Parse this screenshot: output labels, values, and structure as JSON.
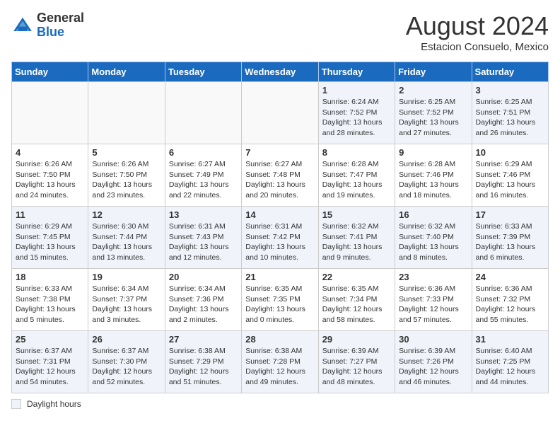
{
  "header": {
    "logo_general": "General",
    "logo_blue": "Blue",
    "month_title": "August 2024",
    "subtitle": "Estacion Consuelo, Mexico"
  },
  "days_of_week": [
    "Sunday",
    "Monday",
    "Tuesday",
    "Wednesday",
    "Thursday",
    "Friday",
    "Saturday"
  ],
  "legend_label": "Daylight hours",
  "weeks": [
    [
      {
        "day": "",
        "info": ""
      },
      {
        "day": "",
        "info": ""
      },
      {
        "day": "",
        "info": ""
      },
      {
        "day": "",
        "info": ""
      },
      {
        "day": "1",
        "info": "Sunrise: 6:24 AM\nSunset: 7:52 PM\nDaylight: 13 hours and 28 minutes."
      },
      {
        "day": "2",
        "info": "Sunrise: 6:25 AM\nSunset: 7:52 PM\nDaylight: 13 hours and 27 minutes."
      },
      {
        "day": "3",
        "info": "Sunrise: 6:25 AM\nSunset: 7:51 PM\nDaylight: 13 hours and 26 minutes."
      }
    ],
    [
      {
        "day": "4",
        "info": "Sunrise: 6:26 AM\nSunset: 7:50 PM\nDaylight: 13 hours and 24 minutes."
      },
      {
        "day": "5",
        "info": "Sunrise: 6:26 AM\nSunset: 7:50 PM\nDaylight: 13 hours and 23 minutes."
      },
      {
        "day": "6",
        "info": "Sunrise: 6:27 AM\nSunset: 7:49 PM\nDaylight: 13 hours and 22 minutes."
      },
      {
        "day": "7",
        "info": "Sunrise: 6:27 AM\nSunset: 7:48 PM\nDaylight: 13 hours and 20 minutes."
      },
      {
        "day": "8",
        "info": "Sunrise: 6:28 AM\nSunset: 7:47 PM\nDaylight: 13 hours and 19 minutes."
      },
      {
        "day": "9",
        "info": "Sunrise: 6:28 AM\nSunset: 7:46 PM\nDaylight: 13 hours and 18 minutes."
      },
      {
        "day": "10",
        "info": "Sunrise: 6:29 AM\nSunset: 7:46 PM\nDaylight: 13 hours and 16 minutes."
      }
    ],
    [
      {
        "day": "11",
        "info": "Sunrise: 6:29 AM\nSunset: 7:45 PM\nDaylight: 13 hours and 15 minutes."
      },
      {
        "day": "12",
        "info": "Sunrise: 6:30 AM\nSunset: 7:44 PM\nDaylight: 13 hours and 13 minutes."
      },
      {
        "day": "13",
        "info": "Sunrise: 6:31 AM\nSunset: 7:43 PM\nDaylight: 13 hours and 12 minutes."
      },
      {
        "day": "14",
        "info": "Sunrise: 6:31 AM\nSunset: 7:42 PM\nDaylight: 13 hours and 10 minutes."
      },
      {
        "day": "15",
        "info": "Sunrise: 6:32 AM\nSunset: 7:41 PM\nDaylight: 13 hours and 9 minutes."
      },
      {
        "day": "16",
        "info": "Sunrise: 6:32 AM\nSunset: 7:40 PM\nDaylight: 13 hours and 8 minutes."
      },
      {
        "day": "17",
        "info": "Sunrise: 6:33 AM\nSunset: 7:39 PM\nDaylight: 13 hours and 6 minutes."
      }
    ],
    [
      {
        "day": "18",
        "info": "Sunrise: 6:33 AM\nSunset: 7:38 PM\nDaylight: 13 hours and 5 minutes."
      },
      {
        "day": "19",
        "info": "Sunrise: 6:34 AM\nSunset: 7:37 PM\nDaylight: 13 hours and 3 minutes."
      },
      {
        "day": "20",
        "info": "Sunrise: 6:34 AM\nSunset: 7:36 PM\nDaylight: 13 hours and 2 minutes."
      },
      {
        "day": "21",
        "info": "Sunrise: 6:35 AM\nSunset: 7:35 PM\nDaylight: 13 hours and 0 minutes."
      },
      {
        "day": "22",
        "info": "Sunrise: 6:35 AM\nSunset: 7:34 PM\nDaylight: 12 hours and 58 minutes."
      },
      {
        "day": "23",
        "info": "Sunrise: 6:36 AM\nSunset: 7:33 PM\nDaylight: 12 hours and 57 minutes."
      },
      {
        "day": "24",
        "info": "Sunrise: 6:36 AM\nSunset: 7:32 PM\nDaylight: 12 hours and 55 minutes."
      }
    ],
    [
      {
        "day": "25",
        "info": "Sunrise: 6:37 AM\nSunset: 7:31 PM\nDaylight: 12 hours and 54 minutes."
      },
      {
        "day": "26",
        "info": "Sunrise: 6:37 AM\nSunset: 7:30 PM\nDaylight: 12 hours and 52 minutes."
      },
      {
        "day": "27",
        "info": "Sunrise: 6:38 AM\nSunset: 7:29 PM\nDaylight: 12 hours and 51 minutes."
      },
      {
        "day": "28",
        "info": "Sunrise: 6:38 AM\nSunset: 7:28 PM\nDaylight: 12 hours and 49 minutes."
      },
      {
        "day": "29",
        "info": "Sunrise: 6:39 AM\nSunset: 7:27 PM\nDaylight: 12 hours and 48 minutes."
      },
      {
        "day": "30",
        "info": "Sunrise: 6:39 AM\nSunset: 7:26 PM\nDaylight: 12 hours and 46 minutes."
      },
      {
        "day": "31",
        "info": "Sunrise: 6:40 AM\nSunset: 7:25 PM\nDaylight: 12 hours and 44 minutes."
      }
    ]
  ]
}
